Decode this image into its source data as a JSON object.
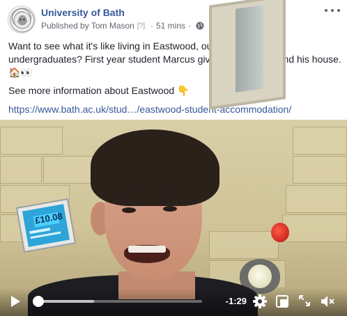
{
  "post": {
    "page_name": "University of Bath",
    "published_by": "Published by Tom Mason",
    "help_marker": "[?]",
    "separator": "·",
    "time": "51 mins",
    "privacy_icon": "globe-icon",
    "more_icon": "more-options-icon",
    "text_line1": "Want to see what it's like living in Eastwood, our on-campus for undergraduates? First year student Marcus gives us a tour around his house. 🏠👀",
    "text_line2": "See more information about Eastwood 👇",
    "link": "https://www.bath.ac.uk/stud…/eastwood-student-accommodation/"
  },
  "video": {
    "sign_text": "£10.08",
    "progress": 0.0,
    "buffered": 0.34,
    "time_remaining": "-1:29",
    "controls": {
      "play_icon": "play-icon",
      "settings_icon": "gear-icon",
      "pip_icon": "picture-in-picture-icon",
      "fullscreen_icon": "fullscreen-icon",
      "volume_icon": "volume-muted-icon"
    }
  },
  "colors": {
    "link": "#365899",
    "text": "#1d2129",
    "meta": "#616770"
  }
}
